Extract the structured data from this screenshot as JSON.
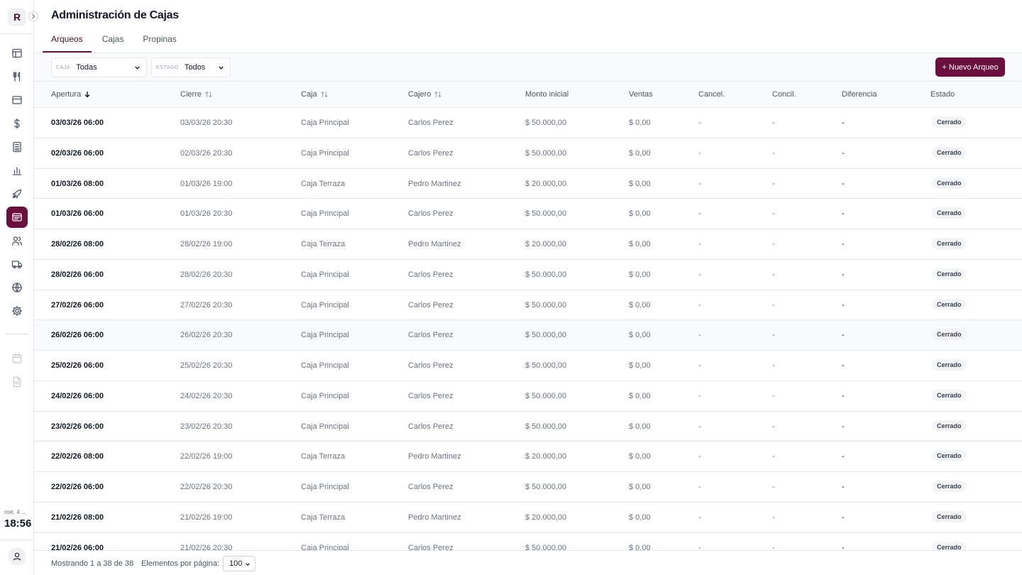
{
  "app": {
    "logo_letter": "R"
  },
  "sidebar": {
    "items": [
      {
        "name": "layout-icon"
      },
      {
        "name": "utensils-icon"
      },
      {
        "name": "menu-card-icon"
      },
      {
        "name": "dollar-icon"
      },
      {
        "name": "calculator-icon"
      },
      {
        "name": "bar-chart-icon"
      },
      {
        "name": "rocket-icon"
      },
      {
        "name": "cash-register-icon",
        "active": true
      },
      {
        "name": "users-icon"
      },
      {
        "name": "truck-icon"
      },
      {
        "name": "globe-icon"
      },
      {
        "name": "gear-icon"
      }
    ],
    "extra_items": [
      {
        "name": "calendar-icon"
      },
      {
        "name": "document-icon"
      }
    ],
    "date": "mié, 4 ...",
    "time": "18:56"
  },
  "page": {
    "title": "Administración de Cajas"
  },
  "tabs": [
    {
      "label": "Arqueos",
      "active": true
    },
    {
      "label": "Cajas"
    },
    {
      "label": "Propinas"
    }
  ],
  "filters": {
    "caja": {
      "label": "CAJA",
      "value": "Todas"
    },
    "estado": {
      "label": "ESTADO",
      "value": "Todos"
    }
  },
  "new_button": "+ Nuevo Arqueo",
  "table": {
    "headers": [
      "Apertura",
      "Cierre",
      "Caja",
      "Cajero",
      "Monto inicial",
      "Ventas",
      "Cancel.",
      "Concil.",
      "Diferencia",
      "Estado"
    ],
    "rows": [
      [
        "03/03/26 06:00",
        "03/03/26 20:30",
        "Caja Principal",
        "Carlos Perez",
        "$ 50.000,00",
        "$ 0,00",
        "-",
        "-",
        "-",
        "Cerrado"
      ],
      [
        "02/03/26 06:00",
        "02/03/26 20:30",
        "Caja Principal",
        "Carlos Perez",
        "$ 50.000,00",
        "$ 0,00",
        "-",
        "-",
        "-",
        "Cerrado"
      ],
      [
        "01/03/26 08:00",
        "01/03/26 19:00",
        "Caja Terraza",
        "Pedro Martinez",
        "$ 20.000,00",
        "$ 0,00",
        "-",
        "-",
        "-",
        "Cerrado"
      ],
      [
        "01/03/26 06:00",
        "01/03/26 20:30",
        "Caja Principal",
        "Carlos Perez",
        "$ 50.000,00",
        "$ 0,00",
        "-",
        "-",
        "-",
        "Cerrado"
      ],
      [
        "28/02/26 08:00",
        "28/02/26 19:00",
        "Caja Terraza",
        "Pedro Martinez",
        "$ 20.000,00",
        "$ 0,00",
        "-",
        "-",
        "-",
        "Cerrado"
      ],
      [
        "28/02/26 06:00",
        "28/02/26 20:30",
        "Caja Principal",
        "Carlos Perez",
        "$ 50.000,00",
        "$ 0,00",
        "-",
        "-",
        "-",
        "Cerrado"
      ],
      [
        "27/02/26 06:00",
        "27/02/26 20:30",
        "Caja Principal",
        "Carlos Perez",
        "$ 50.000,00",
        "$ 0,00",
        "-",
        "-",
        "-",
        "Cerrado"
      ],
      [
        "26/02/26 06:00",
        "26/02/26 20:30",
        "Caja Principal",
        "Carlos Perez",
        "$ 50.000,00",
        "$ 0,00",
        "-",
        "-",
        "-",
        "Cerrado"
      ],
      [
        "25/02/26 06:00",
        "25/02/26 20:30",
        "Caja Principal",
        "Carlos Perez",
        "$ 50.000,00",
        "$ 0,00",
        "-",
        "-",
        "-",
        "Cerrado"
      ],
      [
        "24/02/26 06:00",
        "24/02/26 20:30",
        "Caja Principal",
        "Carlos Perez",
        "$ 50.000,00",
        "$ 0,00",
        "-",
        "-",
        "-",
        "Cerrado"
      ],
      [
        "23/02/26 06:00",
        "23/02/26 20:30",
        "Caja Principal",
        "Carlos Perez",
        "$ 50.000,00",
        "$ 0,00",
        "-",
        "-",
        "-",
        "Cerrado"
      ],
      [
        "22/02/26 08:00",
        "22/02/26 19:00",
        "Caja Terraza",
        "Pedro Martinez",
        "$ 20.000,00",
        "$ 0,00",
        "-",
        "-",
        "-",
        "Cerrado"
      ],
      [
        "22/02/26 06:00",
        "22/02/26 20:30",
        "Caja Principal",
        "Carlos Perez",
        "$ 50.000,00",
        "$ 0,00",
        "-",
        "-",
        "-",
        "Cerrado"
      ],
      [
        "21/02/26 08:00",
        "21/02/26 19:00",
        "Caja Terraza",
        "Pedro Martinez",
        "$ 20.000,00",
        "$ 0,00",
        "-",
        "-",
        "-",
        "Cerrado"
      ],
      [
        "21/02/26 06:00",
        "21/02/26 20:30",
        "Caja Principal",
        "Carlos Perez",
        "$ 50.000,00",
        "$ 0,00",
        "-",
        "-",
        "-",
        "Cerrado"
      ]
    ],
    "highlighted_row": 7
  },
  "footer": {
    "count_text": "Mostrando 1 a 38 de 38",
    "per_page_label": "Elementos por página:",
    "per_page_value": "100"
  },
  "colors": {
    "brand": "#6b0f3f",
    "border": "#e5e7eb"
  }
}
